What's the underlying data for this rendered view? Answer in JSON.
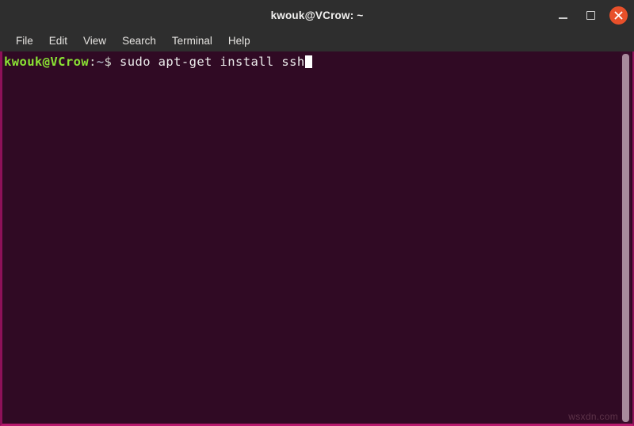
{
  "window": {
    "title": "kwouk@VCrow: ~",
    "controls": {
      "minimize_label": "–",
      "maximize_label": "□",
      "close_label": "✕"
    },
    "colors": {
      "titlebar_bg": "#2e2e2e",
      "terminal_bg": "#300a24",
      "border": "#8e1159",
      "close_button": "#e8502a",
      "prompt_green": "#8ae234",
      "scrollbar_thumb": "#a88a9c"
    }
  },
  "menubar": {
    "items": [
      {
        "label": "File"
      },
      {
        "label": "Edit"
      },
      {
        "label": "View"
      },
      {
        "label": "Search"
      },
      {
        "label": "Terminal"
      },
      {
        "label": "Help"
      }
    ]
  },
  "terminal": {
    "prompt": {
      "user_host": "kwouk@VCrow",
      "separator": ":",
      "path": "~",
      "sigil": "$"
    },
    "command": " sudo apt-get install ssh",
    "cursor_visible": true
  },
  "watermark": {
    "text": "wsxdn.com"
  }
}
